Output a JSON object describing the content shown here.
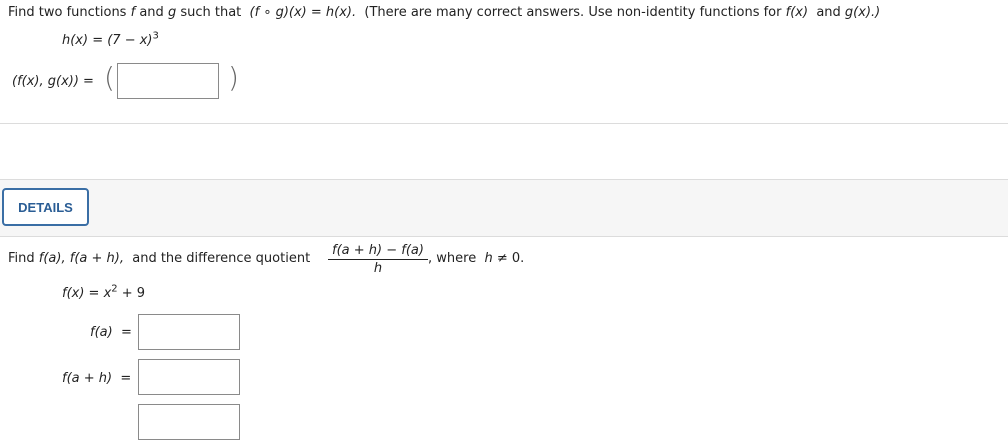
{
  "question1": {
    "prompt_pre": "Find two functions",
    "f": "f",
    "and": "and",
    "g": "g",
    "such_that": "such that",
    "composition": "(f ∘ g)(x) = h(x).",
    "note": "(There are many correct answers. Use non-identity functions for",
    "fx": "f(x)",
    "and2": "and",
    "gx": "g(x).)",
    "h_def_left": "h(x) = (7 − x)",
    "h_def_exp": "3",
    "pair_label": "(f(x), g(x)) =",
    "pair_open": "(",
    "pair_close": ")",
    "answer_value": ""
  },
  "details": {
    "button_label": "DETAILS"
  },
  "question2": {
    "prompt_pre": "Find",
    "fa": "f(a),",
    "fah": "f(a + h),",
    "prompt_mid": "and the difference quotient",
    "frac_num": "f(a + h) − f(a)",
    "frac_den": "h",
    "prompt_tail": ",  where",
    "h_cond": "h",
    "h_neq": "≠ 0.",
    "fx_def_left": "f(x) = x",
    "fx_def_exp": "2",
    "fx_def_right": " + 9",
    "label_fa": "f(a)",
    "label_fah": "f(a + h)",
    "equals": "=",
    "answer_fa": "",
    "answer_fah": "",
    "answer_quotient": ""
  }
}
